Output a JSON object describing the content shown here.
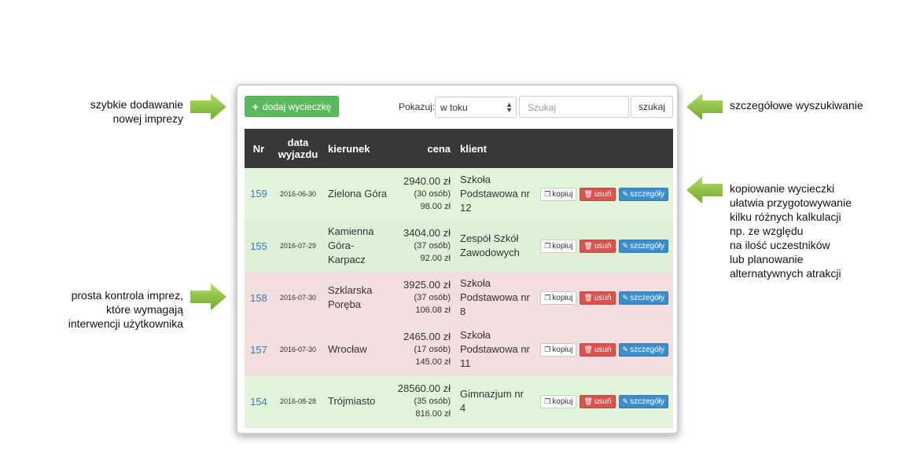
{
  "annotations": {
    "add": [
      "szybkie dodawanie",
      "nowej imprezy"
    ],
    "search": [
      "szczegółowe wyszukiwanie"
    ],
    "copy": [
      "kopiowanie wycieczki",
      "ułatwia przygotowywanie",
      "kilku różnych kalkulacji",
      "np. ze względu",
      "na ilość uczestników",
      "lub planowanie",
      "alternatywnych atrakcji"
    ],
    "control": [
      "prosta kontrola imprez,",
      "które wymagają",
      "interwencji użytkownika"
    ]
  },
  "toolbar": {
    "add_label": "dodaj wycieczkę",
    "show_label": "Pokazuj:",
    "filter_value": "w toku",
    "search_placeholder": "Szukaj",
    "search_button": "szukaj"
  },
  "table": {
    "headers": {
      "nr": "Nr",
      "date": "data wyjazdu",
      "direction": "kierunek",
      "price": "cena",
      "client": "klient"
    },
    "actions": {
      "copy": "kopiuj",
      "delete": "usuń",
      "details": "szczegóły"
    },
    "rows": [
      {
        "nr": "159",
        "date": "2016-06-30",
        "direction": "Zielona Góra",
        "total": "2940.00 zł",
        "persons": "(30 osób)",
        "per_person": "98.00 zł",
        "client": "Szkoła Podstawowa nr 12",
        "status": "ok"
      },
      {
        "nr": "155",
        "date": "2016-07-29",
        "direction": "Kamienna Góra-Karpacz",
        "total": "3404.00 zł",
        "persons": "(37 osób)",
        "per_person": "92.00 zł",
        "client": "Zespół Szkół Zawodowych",
        "status": "ok"
      },
      {
        "nr": "158",
        "date": "2016-07-30",
        "direction": "Szklarska Poręba",
        "total": "3925.00 zł",
        "persons": "(37 osób)",
        "per_person": "106.08 zł",
        "client": "Szkoła Podstawowa nr 8",
        "status": "warn"
      },
      {
        "nr": "157",
        "date": "2016-07-30",
        "direction": "Wrocław",
        "total": "2465.00 zł",
        "persons": "(17 osób)",
        "per_person": "145.00 zł",
        "client": "Szkoła Podstawowa nr 11",
        "status": "warn"
      },
      {
        "nr": "154",
        "date": "2016-08-28",
        "direction": "Trójmiasto",
        "total": "28560.00 zł",
        "persons": "(35 osób)",
        "per_person": "816.00 zł",
        "client": "Gimnazjum nr 4",
        "status": "ok"
      }
    ]
  },
  "colors": {
    "accent_green": "#5cb85c",
    "arrow_green": "#8cc63f",
    "header_dark": "#383838",
    "row_ok": "#dff0d8",
    "row_warn": "#f2dede",
    "danger": "#d9534f",
    "info": "#3c8dcc",
    "link": "#337ab7"
  }
}
